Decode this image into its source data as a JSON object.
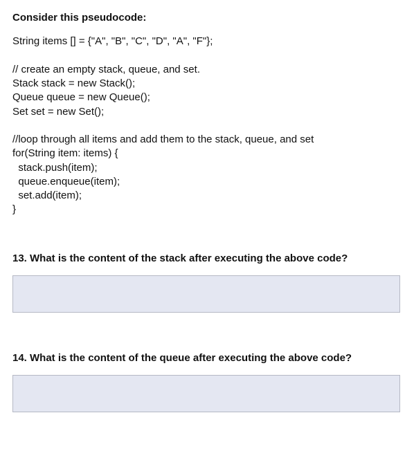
{
  "intro": "Consider this pseudocode:",
  "code_lines": [
    "String items [] = {\"A\", \"B\", \"C\", \"D\", \"A\", \"F\"};",
    "",
    "// create an empty stack, queue, and set.",
    "Stack stack = new Stack();",
    "Queue queue = new Queue();",
    "Set set = new Set();",
    "",
    "//loop through all items and add them to the stack, queue, and set",
    "for(String item: items) {",
    "  stack.push(item);",
    "  queue.enqueue(item);",
    "  set.add(item);",
    "}"
  ],
  "questions": {
    "q13_prefix": "13. What is the content of the ",
    "q13_bold": "stack",
    "q13_suffix": " after executing the above code?",
    "q14_prefix": "14. What is the content of the ",
    "q14_bold": "queue",
    "q14_suffix": " after executing the above code?"
  },
  "answers": {
    "q13": "",
    "q14": ""
  }
}
